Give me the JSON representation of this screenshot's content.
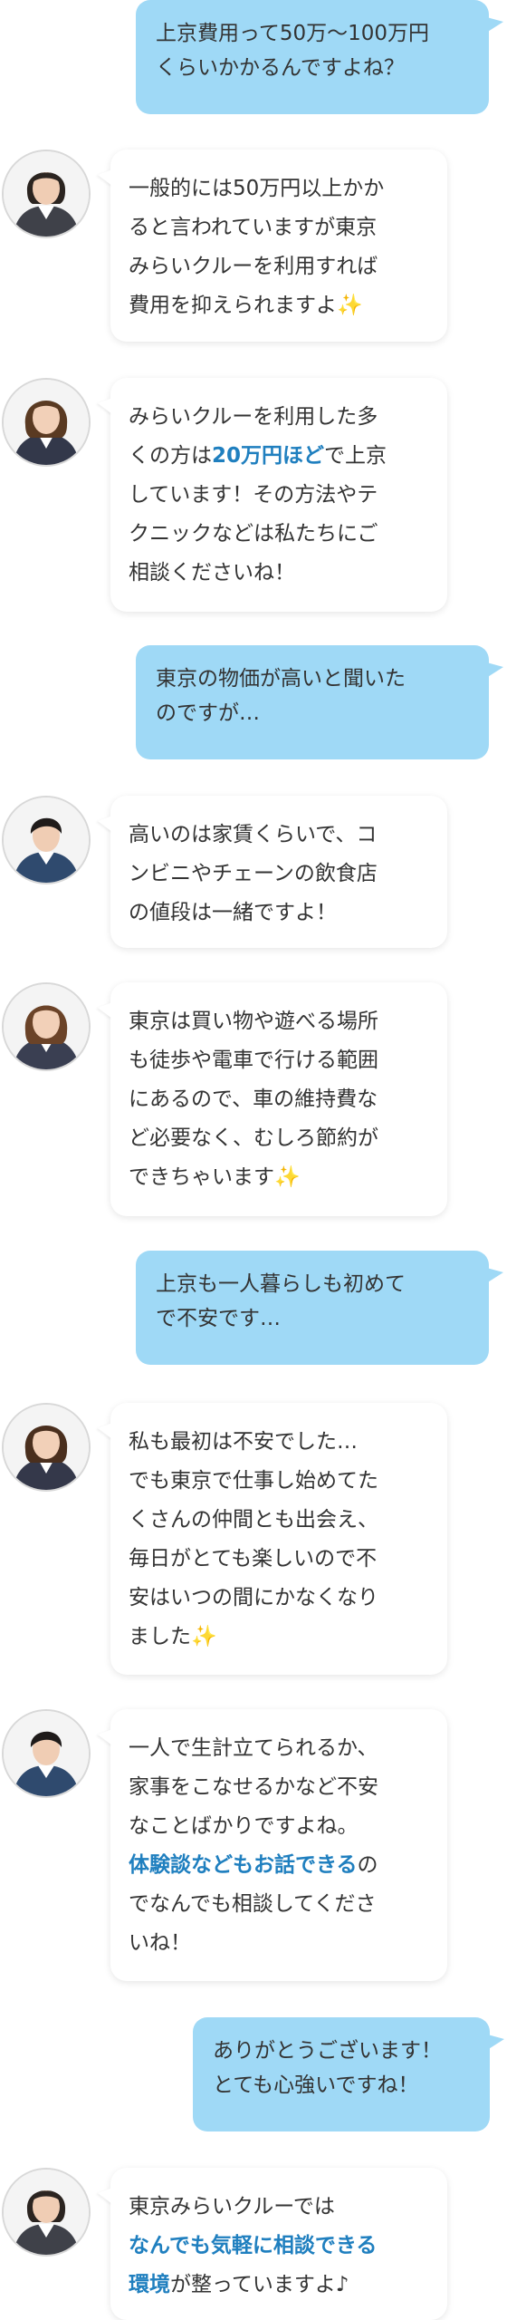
{
  "messages": [
    {
      "sender": "user",
      "lines": [
        "上京費用って50万〜100万円",
        "くらいかかるんですよね？"
      ]
    },
    {
      "sender": "staff",
      "avatar": "staff-avatar-1",
      "lines": [
        [
          {
            "t": "一般的には50万円以上かか"
          }
        ],
        [
          {
            "t": "ると言われていますが東京"
          }
        ],
        [
          {
            "t": "みらいクルーを利用すれば"
          }
        ],
        [
          {
            "t": "費用を抑えられますよ"
          },
          {
            "t": "✨",
            "spark": true
          }
        ]
      ]
    },
    {
      "sender": "staff",
      "avatar": "staff-avatar-2",
      "lines": [
        [
          {
            "t": "みらいクルーを利用した多"
          }
        ],
        [
          {
            "t": "くの方は"
          },
          {
            "t": "20万円ほど",
            "hl": true
          },
          {
            "t": "で上京"
          }
        ],
        [
          {
            "t": "しています！その方法やテ"
          }
        ],
        [
          {
            "t": "クニックなどは私たちにご"
          }
        ],
        [
          {
            "t": "相談くださいね！"
          }
        ]
      ]
    },
    {
      "sender": "user",
      "lines": [
        "東京の物価が高いと聞いた",
        "のですが…"
      ]
    },
    {
      "sender": "staff",
      "avatar": "staff-avatar-3",
      "lines": [
        [
          {
            "t": "高いのは家賃くらいで、コ"
          }
        ],
        [
          {
            "t": "ンビニやチェーンの飲食店"
          }
        ],
        [
          {
            "t": "の値段は一緒ですよ！"
          }
        ]
      ]
    },
    {
      "sender": "staff",
      "avatar": "staff-avatar-4",
      "lines": [
        [
          {
            "t": "東京は買い物や遊べる場所"
          }
        ],
        [
          {
            "t": "も徒歩や電車で行ける範囲"
          }
        ],
        [
          {
            "t": "にあるので、車の維持費な"
          }
        ],
        [
          {
            "t": "ど必要なく、むしろ節約が"
          }
        ],
        [
          {
            "t": "できちゃいます"
          },
          {
            "t": "✨",
            "spark": true
          }
        ]
      ]
    },
    {
      "sender": "user",
      "lines": [
        "上京も一人暮らしも初めて",
        "で不安です…"
      ]
    },
    {
      "sender": "staff",
      "avatar": "staff-avatar-5",
      "lines": [
        [
          {
            "t": "私も最初は不安でした…"
          }
        ],
        [
          {
            "t": "でも東京で仕事し始めてた"
          }
        ],
        [
          {
            "t": "くさんの仲間とも出会え、"
          }
        ],
        [
          {
            "t": "毎日がとても楽しいので不"
          }
        ],
        [
          {
            "t": "安はいつの間にかなくなり"
          }
        ],
        [
          {
            "t": "ました"
          },
          {
            "t": "✨",
            "spark": true
          }
        ]
      ]
    },
    {
      "sender": "staff",
      "avatar": "staff-avatar-6",
      "lines": [
        [
          {
            "t": "一人で生計立てられるか、"
          }
        ],
        [
          {
            "t": "家事をこなせるかなど不安"
          }
        ],
        [
          {
            "t": "なことばかりですよね。"
          }
        ],
        [
          {
            "t": "体験談などもお話できる",
            "hl": true
          },
          {
            "t": "の"
          }
        ],
        [
          {
            "t": "でなんでも相談してくださ"
          }
        ],
        [
          {
            "t": "いね！"
          }
        ]
      ]
    },
    {
      "sender": "user",
      "lines": [
        "ありがとうございます！",
        "とても心強いですね！"
      ]
    },
    {
      "sender": "staff",
      "avatar": "staff-avatar-7",
      "lines": [
        [
          {
            "t": "東京みらいクルーでは"
          }
        ],
        [
          {
            "t": "なんでも気軽に相談できる",
            "hl": true
          }
        ],
        [
          {
            "t": "環境",
            "hl": true
          },
          {
            "t": "が整っていますよ♪"
          }
        ]
      ]
    }
  ]
}
